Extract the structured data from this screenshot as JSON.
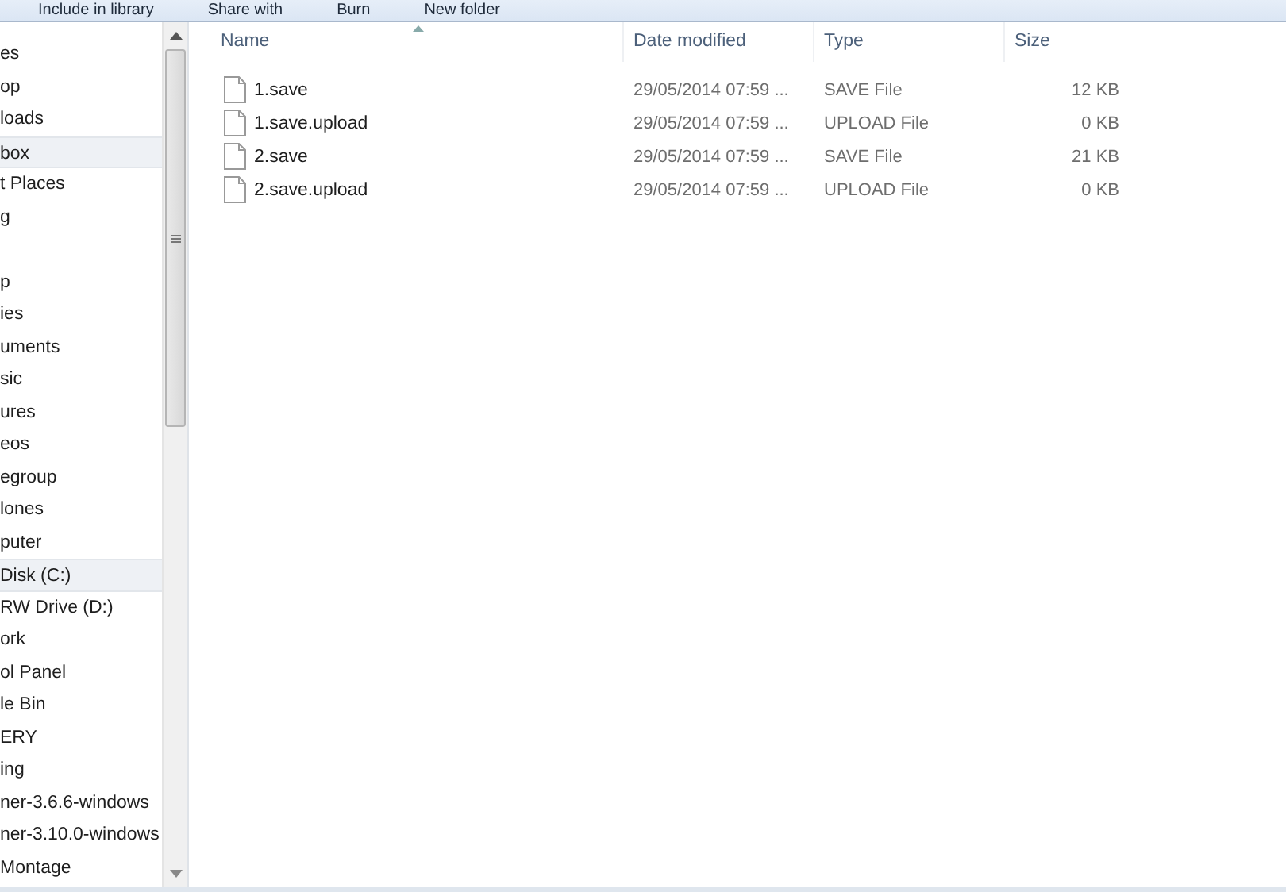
{
  "toolbar": [
    "Include in library",
    "Share with",
    "Burn",
    "New folder"
  ],
  "sidebar": {
    "items": [
      {
        "label": "es",
        "selected": false
      },
      {
        "label": "op",
        "selected": false
      },
      {
        "label": "loads",
        "selected": false
      },
      {
        "label": "box",
        "selected": true
      },
      {
        "label": "t Places",
        "selected": false
      },
      {
        "label": "g",
        "selected": false
      },
      {
        "label": "p",
        "selected": false
      },
      {
        "label": "ies",
        "selected": false
      },
      {
        "label": "uments",
        "selected": false
      },
      {
        "label": "sic",
        "selected": false
      },
      {
        "label": "ures",
        "selected": false
      },
      {
        "label": "eos",
        "selected": false
      },
      {
        "label": "egroup",
        "selected": false
      },
      {
        "label": "lones",
        "selected": false
      },
      {
        "label": "puter",
        "selected": false
      },
      {
        "label": "Disk (C:)",
        "selected": true
      },
      {
        "label": "RW Drive (D:)",
        "selected": false
      },
      {
        "label": "ork",
        "selected": false
      },
      {
        "label": "ol Panel",
        "selected": false
      },
      {
        "label": "le Bin",
        "selected": false
      },
      {
        "label": "ERY",
        "selected": false
      },
      {
        "label": "ing",
        "selected": false
      },
      {
        "label": "ner-3.6.6-windows",
        "selected": false
      },
      {
        "label": "ner-3.10.0-windows",
        "selected": false
      },
      {
        "label": "Montage",
        "selected": false
      }
    ]
  },
  "table": {
    "columns": [
      "Name",
      "Date modified",
      "Type",
      "Size"
    ],
    "rows": [
      {
        "name": "1.save",
        "date": "29/05/2014 07:59 ...",
        "type": "SAVE File",
        "size": "12 KB"
      },
      {
        "name": "1.save.upload",
        "date": "29/05/2014 07:59 ...",
        "type": "UPLOAD File",
        "size": "0 KB"
      },
      {
        "name": "2.save",
        "date": "29/05/2014 07:59 ...",
        "type": "SAVE File",
        "size": "21 KB"
      },
      {
        "name": "2.save.upload",
        "date": "29/05/2014 07:59 ...",
        "type": "UPLOAD File",
        "size": "0 KB"
      }
    ]
  }
}
